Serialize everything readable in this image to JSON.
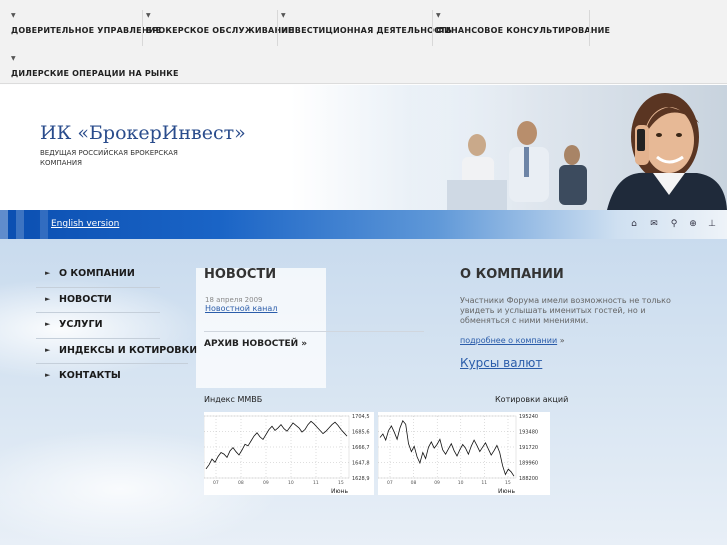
{
  "nav": {
    "items": [
      "ДОВЕРИТЕЛЬНОЕ УПРАВЛЕНИЕ",
      "БРОКЕРСКОЕ ОБСЛУЖИВАНИЕ",
      "ИНВЕСТИЦИОННАЯ ДЕЯТЕЛЬНОСТЬ",
      "ФИНАНСОВОЕ КОНСУЛЬТИРОВАНИЕ",
      "ДИЛЕРСКИЕ ОПЕРАЦИИ НА РЫНКЕ"
    ]
  },
  "header": {
    "title": "ИК «БрокерИнвест»",
    "subtitle": "ВЕДУЩАЯ РОССИЙСКАЯ БРОКЕРСКАЯ КОМПАНИЯ"
  },
  "band": {
    "english": "English version",
    "icons": [
      "home-icon",
      "mail-icon",
      "search-icon",
      "zoom-icon",
      "sitemap-icon"
    ]
  },
  "menu": {
    "items": [
      "О КОМПАНИИ",
      "НОВОСТИ",
      "УСЛУГИ",
      "ИНДЕКСЫ И КОТИРОВКИ",
      "КОНТАКТЫ"
    ]
  },
  "news": {
    "title": "НОВОСТИ",
    "date": "18 апреля 2009",
    "link": "Новостной канал",
    "archive": "АРХИВ НОВОСТЕЙ »"
  },
  "about": {
    "title": "О КОМПАНИИ",
    "text": "Участники Форума имели возможность не только увидеть и услышать именитых гостей, но и обменяться с ними мнениями.",
    "more": "подробнее о компании",
    "more_arrow": "»",
    "rates": "Курсы валют"
  },
  "chart_data": [
    {
      "type": "line",
      "title": "Индекс ММВБ",
      "yticks": [
        "1704,5",
        "1685,6",
        "1666,7",
        "1647,8",
        "1628,9"
      ],
      "xticks": [
        "07",
        "08",
        "09",
        "10",
        "11",
        "15"
      ],
      "xlabel": "Июнь",
      "ylim": [
        1628.9,
        1704.5
      ],
      "values": [
        1640,
        1645,
        1652,
        1648,
        1655,
        1660,
        1658,
        1654,
        1662,
        1666,
        1661,
        1657,
        1663,
        1670,
        1668,
        1674,
        1680,
        1684,
        1679,
        1676,
        1682,
        1688,
        1692,
        1687,
        1690,
        1694,
        1689,
        1686,
        1691,
        1696,
        1693,
        1690,
        1685,
        1688,
        1694,
        1698,
        1695,
        1691,
        1687,
        1683,
        1686,
        1690,
        1694,
        1697,
        1693,
        1688,
        1684,
        1680
      ]
    },
    {
      "type": "line",
      "title": "Котировки акций",
      "yticks": [
        "195240",
        "193480",
        "191720",
        "189960",
        "188200"
      ],
      "xticks": [
        "07",
        "08",
        "09",
        "10",
        "11",
        "15"
      ],
      "xlabel": "Июнь",
      "ylim": [
        188200,
        195240
      ],
      "values": [
        192800,
        193200,
        192500,
        193600,
        194100,
        193400,
        192600,
        193900,
        194700,
        194300,
        192100,
        191200,
        191800,
        190600,
        189900,
        191100,
        190400,
        191700,
        192300,
        191600,
        192000,
        192600,
        191400,
        190900,
        191500,
        192100,
        191300,
        190700,
        191400,
        192000,
        191600,
        190900,
        191800,
        192500,
        191900,
        191200,
        191700,
        192200,
        191500,
        190800,
        191300,
        191900,
        191100,
        189600,
        188600,
        189200,
        188900,
        188400
      ]
    }
  ]
}
